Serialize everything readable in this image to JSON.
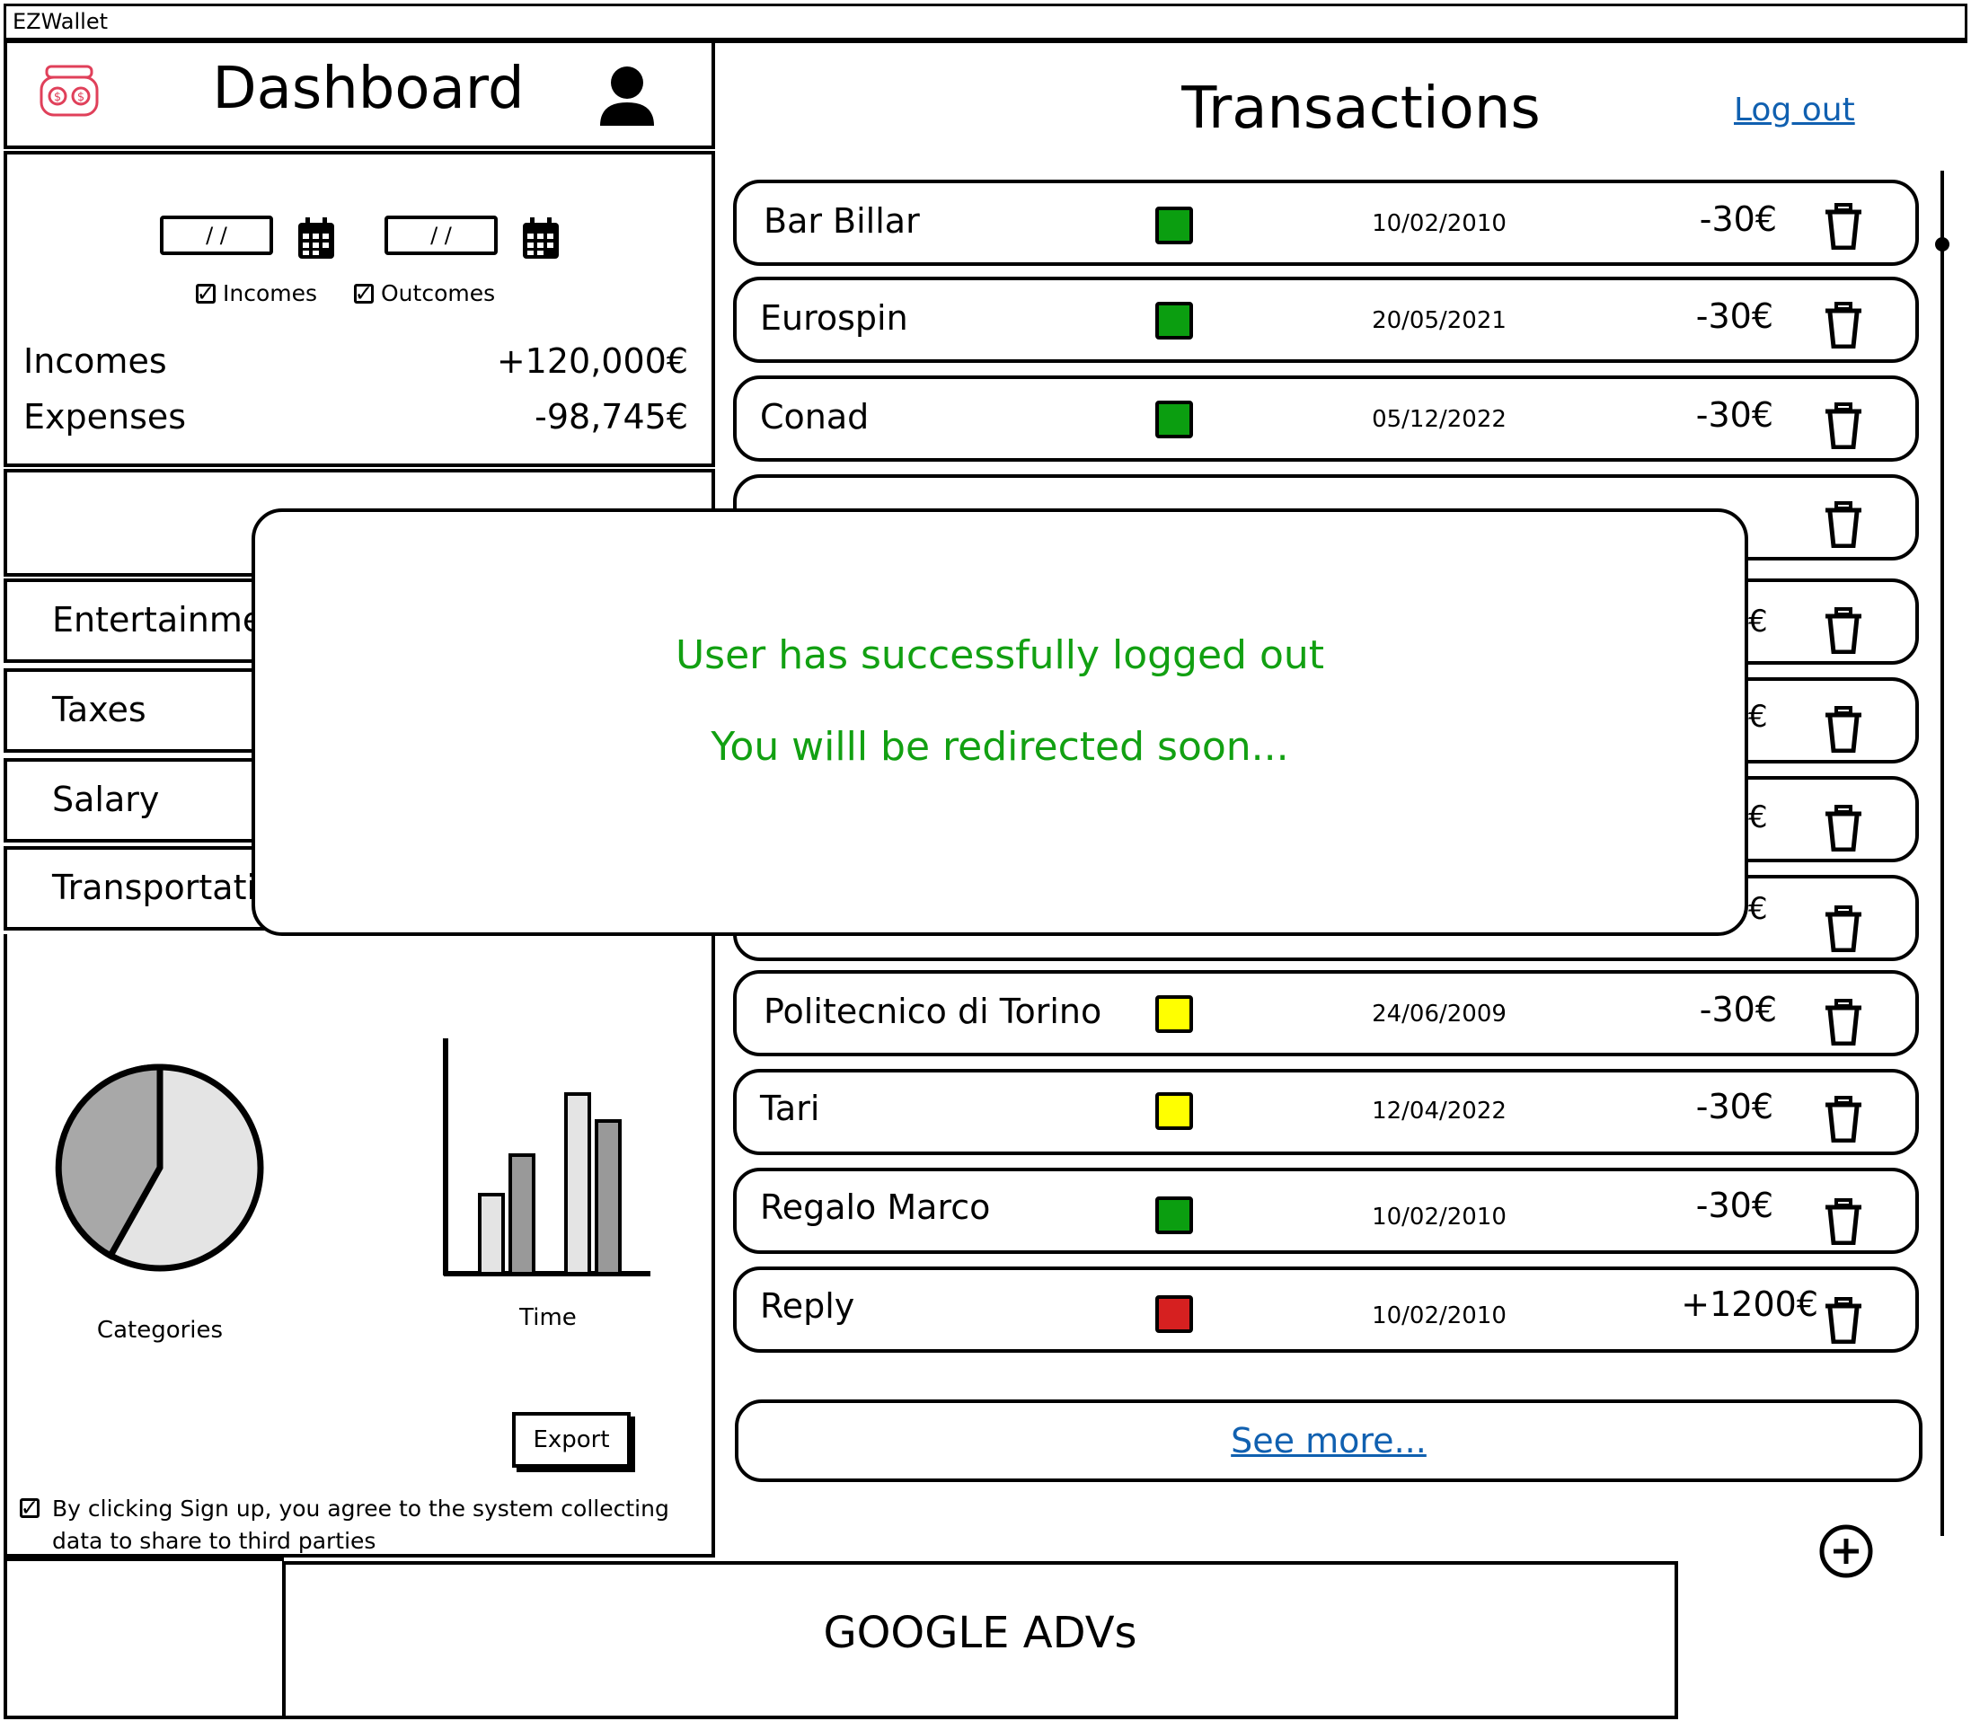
{
  "window": {
    "title": "EZWallet"
  },
  "dashboard": {
    "title": "Dashboard",
    "filters": {
      "date_from_placeholder": "/ /",
      "date_to_placeholder": "/ /",
      "incomes_checkbox": "Incomes",
      "outcomes_checkbox": "Outcomes",
      "incomes_checked": true,
      "outcomes_checked": true
    },
    "summary": {
      "incomes_label": "Incomes",
      "incomes_value": "+120,000€",
      "expenses_label": "Expenses",
      "expenses_value": "-98,745€"
    },
    "categories": [
      {
        "label": "Entertainme"
      },
      {
        "label": "Taxes"
      },
      {
        "label": "Salary"
      },
      {
        "label": "Transportati"
      }
    ],
    "charts": {
      "pie_label": "Categories",
      "bar_label": "Time"
    },
    "export_label": "Export",
    "consent_text": "By clicking Sign up, you agree to the system collecting data to share to third parties",
    "consent_checked": true
  },
  "transactions": {
    "title": "Transactions",
    "logout_label": "Log out",
    "see_more_label": "See more...",
    "rows": [
      {
        "name": "Bar Billar",
        "date": "10/02/2010",
        "amount": "-30€",
        "color": "#0b9e10"
      },
      {
        "name": "Eurospin",
        "date": "20/05/2021",
        "amount": "-30€",
        "color": "#0b9e10"
      },
      {
        "name": "Conad",
        "date": "05/12/2022",
        "amount": "-30€",
        "color": "#0b9e10"
      },
      {
        "name": "Politecnico di Torino",
        "date": "24/06/2009",
        "amount": "-30€",
        "color": "#ffff00"
      },
      {
        "name": "Tari",
        "date": "12/04/2022",
        "amount": "-30€",
        "color": "#ffff00"
      },
      {
        "name": "Regalo Marco",
        "date": "10/02/2010",
        "amount": "-30€",
        "color": "#0b9e10"
      },
      {
        "name": "Reply",
        "date": "10/02/2010",
        "amount": "+1200€",
        "color": "#d62020"
      }
    ],
    "partial_amounts": [
      "€",
      "€",
      "€",
      "€"
    ]
  },
  "ad": {
    "label": "GOOGLE ADVs"
  },
  "modal": {
    "line1": "User has successfully logged out",
    "line2": "You willl be redirected soon...",
    "color": "#12a012"
  }
}
